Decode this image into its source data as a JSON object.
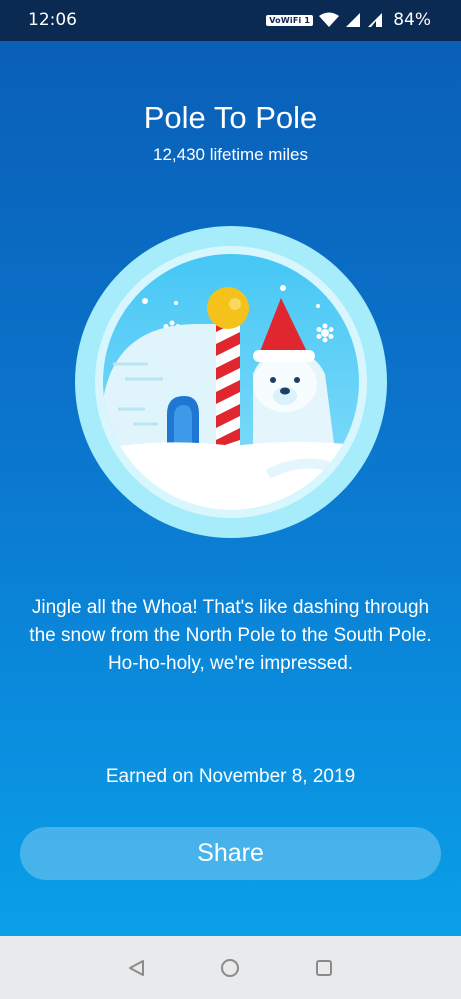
{
  "status_bar": {
    "time": "12:06",
    "vowifi": "VoWiFi 1",
    "battery": "84%"
  },
  "achievement": {
    "title": "Pole To Pole",
    "subtitle": "12,430 lifetime miles",
    "description": "Jingle all the Whoa! That's like dashing through the snow from the North Pole to the South Pole. Ho-ho-holy, we're impressed.",
    "earned": "Earned on November 8, 2019",
    "badge_icon": "north-pole-polar-bear-badge"
  },
  "actions": {
    "share_label": "Share"
  },
  "nav": {
    "back_icon": "back-triangle-icon",
    "home_icon": "home-circle-icon",
    "recents_icon": "recents-square-icon"
  },
  "colors": {
    "background_top": "#0a5db4",
    "background_bottom": "#0aa0e8",
    "status_bar": "#0b2a52",
    "badge_ring": "#a6ecfb",
    "pole_stripe": "#e0262f",
    "pole_top": "#f5c21b"
  }
}
